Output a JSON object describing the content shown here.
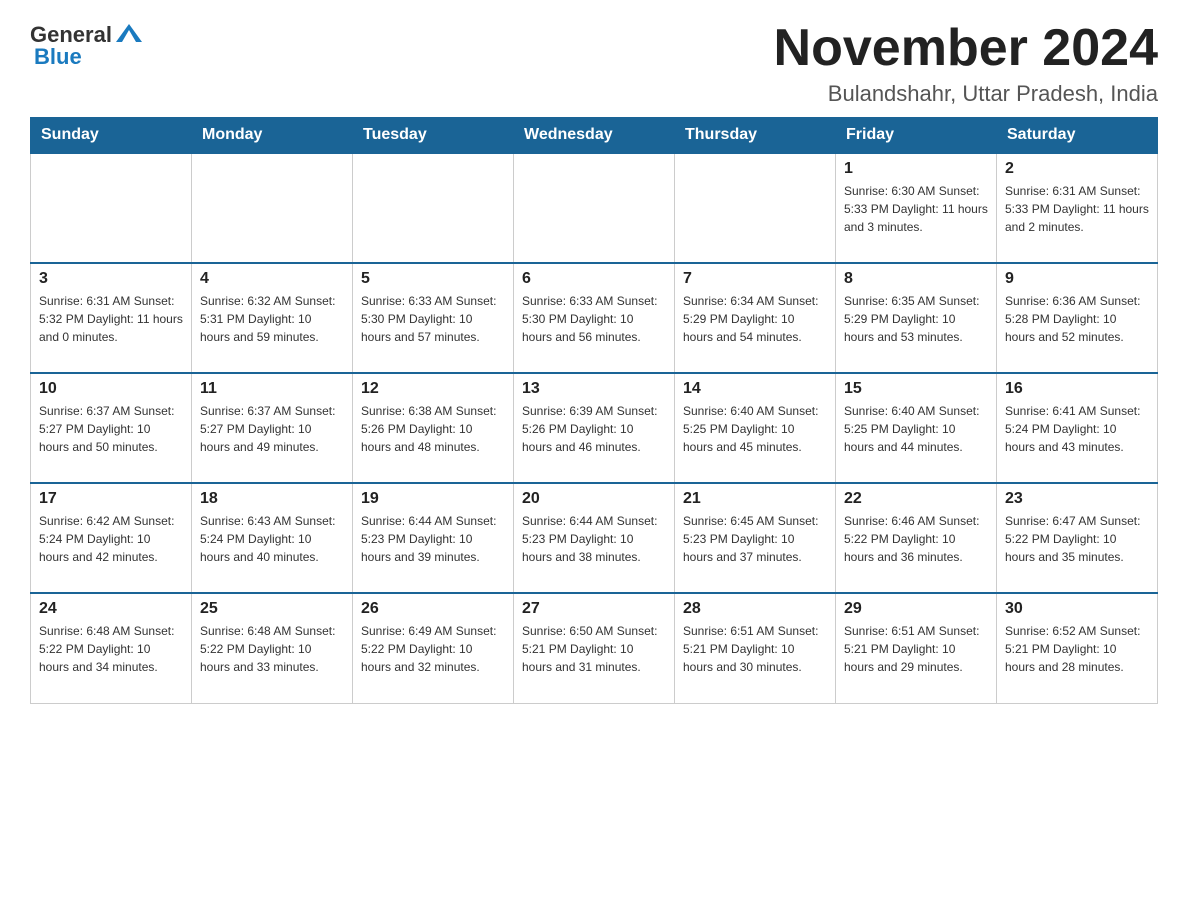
{
  "header": {
    "logo_general": "General",
    "logo_blue": "Blue",
    "title": "November 2024",
    "subtitle": "Bulandshahr, Uttar Pradesh, India"
  },
  "days_of_week": [
    "Sunday",
    "Monday",
    "Tuesday",
    "Wednesday",
    "Thursday",
    "Friday",
    "Saturday"
  ],
  "weeks": [
    [
      {
        "day": "",
        "info": ""
      },
      {
        "day": "",
        "info": ""
      },
      {
        "day": "",
        "info": ""
      },
      {
        "day": "",
        "info": ""
      },
      {
        "day": "",
        "info": ""
      },
      {
        "day": "1",
        "info": "Sunrise: 6:30 AM\nSunset: 5:33 PM\nDaylight: 11 hours and 3 minutes."
      },
      {
        "day": "2",
        "info": "Sunrise: 6:31 AM\nSunset: 5:33 PM\nDaylight: 11 hours and 2 minutes."
      }
    ],
    [
      {
        "day": "3",
        "info": "Sunrise: 6:31 AM\nSunset: 5:32 PM\nDaylight: 11 hours and 0 minutes."
      },
      {
        "day": "4",
        "info": "Sunrise: 6:32 AM\nSunset: 5:31 PM\nDaylight: 10 hours and 59 minutes."
      },
      {
        "day": "5",
        "info": "Sunrise: 6:33 AM\nSunset: 5:30 PM\nDaylight: 10 hours and 57 minutes."
      },
      {
        "day": "6",
        "info": "Sunrise: 6:33 AM\nSunset: 5:30 PM\nDaylight: 10 hours and 56 minutes."
      },
      {
        "day": "7",
        "info": "Sunrise: 6:34 AM\nSunset: 5:29 PM\nDaylight: 10 hours and 54 minutes."
      },
      {
        "day": "8",
        "info": "Sunrise: 6:35 AM\nSunset: 5:29 PM\nDaylight: 10 hours and 53 minutes."
      },
      {
        "day": "9",
        "info": "Sunrise: 6:36 AM\nSunset: 5:28 PM\nDaylight: 10 hours and 52 minutes."
      }
    ],
    [
      {
        "day": "10",
        "info": "Sunrise: 6:37 AM\nSunset: 5:27 PM\nDaylight: 10 hours and 50 minutes."
      },
      {
        "day": "11",
        "info": "Sunrise: 6:37 AM\nSunset: 5:27 PM\nDaylight: 10 hours and 49 minutes."
      },
      {
        "day": "12",
        "info": "Sunrise: 6:38 AM\nSunset: 5:26 PM\nDaylight: 10 hours and 48 minutes."
      },
      {
        "day": "13",
        "info": "Sunrise: 6:39 AM\nSunset: 5:26 PM\nDaylight: 10 hours and 46 minutes."
      },
      {
        "day": "14",
        "info": "Sunrise: 6:40 AM\nSunset: 5:25 PM\nDaylight: 10 hours and 45 minutes."
      },
      {
        "day": "15",
        "info": "Sunrise: 6:40 AM\nSunset: 5:25 PM\nDaylight: 10 hours and 44 minutes."
      },
      {
        "day": "16",
        "info": "Sunrise: 6:41 AM\nSunset: 5:24 PM\nDaylight: 10 hours and 43 minutes."
      }
    ],
    [
      {
        "day": "17",
        "info": "Sunrise: 6:42 AM\nSunset: 5:24 PM\nDaylight: 10 hours and 42 minutes."
      },
      {
        "day": "18",
        "info": "Sunrise: 6:43 AM\nSunset: 5:24 PM\nDaylight: 10 hours and 40 minutes."
      },
      {
        "day": "19",
        "info": "Sunrise: 6:44 AM\nSunset: 5:23 PM\nDaylight: 10 hours and 39 minutes."
      },
      {
        "day": "20",
        "info": "Sunrise: 6:44 AM\nSunset: 5:23 PM\nDaylight: 10 hours and 38 minutes."
      },
      {
        "day": "21",
        "info": "Sunrise: 6:45 AM\nSunset: 5:23 PM\nDaylight: 10 hours and 37 minutes."
      },
      {
        "day": "22",
        "info": "Sunrise: 6:46 AM\nSunset: 5:22 PM\nDaylight: 10 hours and 36 minutes."
      },
      {
        "day": "23",
        "info": "Sunrise: 6:47 AM\nSunset: 5:22 PM\nDaylight: 10 hours and 35 minutes."
      }
    ],
    [
      {
        "day": "24",
        "info": "Sunrise: 6:48 AM\nSunset: 5:22 PM\nDaylight: 10 hours and 34 minutes."
      },
      {
        "day": "25",
        "info": "Sunrise: 6:48 AM\nSunset: 5:22 PM\nDaylight: 10 hours and 33 minutes."
      },
      {
        "day": "26",
        "info": "Sunrise: 6:49 AM\nSunset: 5:22 PM\nDaylight: 10 hours and 32 minutes."
      },
      {
        "day": "27",
        "info": "Sunrise: 6:50 AM\nSunset: 5:21 PM\nDaylight: 10 hours and 31 minutes."
      },
      {
        "day": "28",
        "info": "Sunrise: 6:51 AM\nSunset: 5:21 PM\nDaylight: 10 hours and 30 minutes."
      },
      {
        "day": "29",
        "info": "Sunrise: 6:51 AM\nSunset: 5:21 PM\nDaylight: 10 hours and 29 minutes."
      },
      {
        "day": "30",
        "info": "Sunrise: 6:52 AM\nSunset: 5:21 PM\nDaylight: 10 hours and 28 minutes."
      }
    ]
  ]
}
